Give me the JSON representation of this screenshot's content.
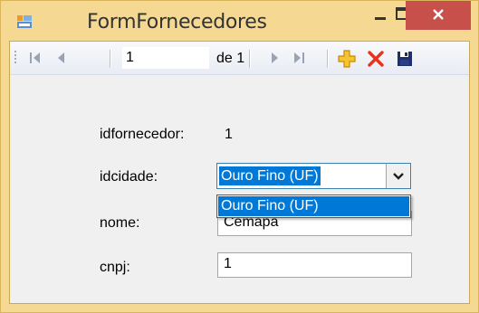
{
  "window": {
    "title": "FormFornecedores",
    "close_color": "#c8504b",
    "frame_color": "#f5d992"
  },
  "navigator": {
    "position_value": "1",
    "count_label": "de 1",
    "buttons": [
      "move-first-icon",
      "move-previous-icon",
      "move-next-icon",
      "move-last-icon",
      "add-new-icon",
      "delete-icon",
      "save-icon"
    ]
  },
  "form": {
    "idfornecedor_label": "idfornecedor:",
    "idfornecedor_value": "1",
    "idcidade_label": "idcidade:",
    "idcidade_value": "Ouro Fino (UF)",
    "idcidade_options": [
      "Ouro Fino (UF)"
    ],
    "nome_label": "nome:",
    "nome_value": "Cemapa",
    "cnpj_label": "cnpj:",
    "cnpj_value": "1"
  },
  "colors": {
    "selection": "#0078d7",
    "add_icon": "#f5b400",
    "delete_icon": "#e8321e",
    "save_icon": "#1e2f6b"
  }
}
